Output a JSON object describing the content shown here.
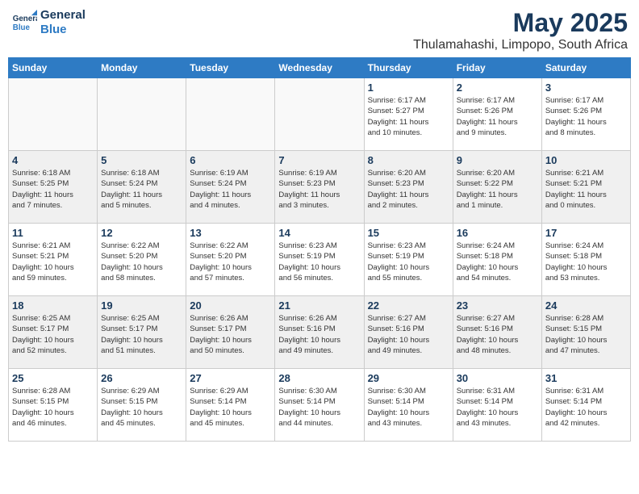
{
  "logo": {
    "line1": "General",
    "line2": "Blue"
  },
  "title": "May 2025",
  "location": "Thulamahashi, Limpopo, South Africa",
  "weekdays": [
    "Sunday",
    "Monday",
    "Tuesday",
    "Wednesday",
    "Thursday",
    "Friday",
    "Saturday"
  ],
  "weeks": [
    [
      {
        "day": "",
        "text": ""
      },
      {
        "day": "",
        "text": ""
      },
      {
        "day": "",
        "text": ""
      },
      {
        "day": "",
        "text": ""
      },
      {
        "day": "1",
        "text": "Sunrise: 6:17 AM\nSunset: 5:27 PM\nDaylight: 11 hours\nand 10 minutes."
      },
      {
        "day": "2",
        "text": "Sunrise: 6:17 AM\nSunset: 5:26 PM\nDaylight: 11 hours\nand 9 minutes."
      },
      {
        "day": "3",
        "text": "Sunrise: 6:17 AM\nSunset: 5:26 PM\nDaylight: 11 hours\nand 8 minutes."
      }
    ],
    [
      {
        "day": "4",
        "text": "Sunrise: 6:18 AM\nSunset: 5:25 PM\nDaylight: 11 hours\nand 7 minutes."
      },
      {
        "day": "5",
        "text": "Sunrise: 6:18 AM\nSunset: 5:24 PM\nDaylight: 11 hours\nand 5 minutes."
      },
      {
        "day": "6",
        "text": "Sunrise: 6:19 AM\nSunset: 5:24 PM\nDaylight: 11 hours\nand 4 minutes."
      },
      {
        "day": "7",
        "text": "Sunrise: 6:19 AM\nSunset: 5:23 PM\nDaylight: 11 hours\nand 3 minutes."
      },
      {
        "day": "8",
        "text": "Sunrise: 6:20 AM\nSunset: 5:23 PM\nDaylight: 11 hours\nand 2 minutes."
      },
      {
        "day": "9",
        "text": "Sunrise: 6:20 AM\nSunset: 5:22 PM\nDaylight: 11 hours\nand 1 minute."
      },
      {
        "day": "10",
        "text": "Sunrise: 6:21 AM\nSunset: 5:21 PM\nDaylight: 11 hours\nand 0 minutes."
      }
    ],
    [
      {
        "day": "11",
        "text": "Sunrise: 6:21 AM\nSunset: 5:21 PM\nDaylight: 10 hours\nand 59 minutes."
      },
      {
        "day": "12",
        "text": "Sunrise: 6:22 AM\nSunset: 5:20 PM\nDaylight: 10 hours\nand 58 minutes."
      },
      {
        "day": "13",
        "text": "Sunrise: 6:22 AM\nSunset: 5:20 PM\nDaylight: 10 hours\nand 57 minutes."
      },
      {
        "day": "14",
        "text": "Sunrise: 6:23 AM\nSunset: 5:19 PM\nDaylight: 10 hours\nand 56 minutes."
      },
      {
        "day": "15",
        "text": "Sunrise: 6:23 AM\nSunset: 5:19 PM\nDaylight: 10 hours\nand 55 minutes."
      },
      {
        "day": "16",
        "text": "Sunrise: 6:24 AM\nSunset: 5:18 PM\nDaylight: 10 hours\nand 54 minutes."
      },
      {
        "day": "17",
        "text": "Sunrise: 6:24 AM\nSunset: 5:18 PM\nDaylight: 10 hours\nand 53 minutes."
      }
    ],
    [
      {
        "day": "18",
        "text": "Sunrise: 6:25 AM\nSunset: 5:17 PM\nDaylight: 10 hours\nand 52 minutes."
      },
      {
        "day": "19",
        "text": "Sunrise: 6:25 AM\nSunset: 5:17 PM\nDaylight: 10 hours\nand 51 minutes."
      },
      {
        "day": "20",
        "text": "Sunrise: 6:26 AM\nSunset: 5:17 PM\nDaylight: 10 hours\nand 50 minutes."
      },
      {
        "day": "21",
        "text": "Sunrise: 6:26 AM\nSunset: 5:16 PM\nDaylight: 10 hours\nand 49 minutes."
      },
      {
        "day": "22",
        "text": "Sunrise: 6:27 AM\nSunset: 5:16 PM\nDaylight: 10 hours\nand 49 minutes."
      },
      {
        "day": "23",
        "text": "Sunrise: 6:27 AM\nSunset: 5:16 PM\nDaylight: 10 hours\nand 48 minutes."
      },
      {
        "day": "24",
        "text": "Sunrise: 6:28 AM\nSunset: 5:15 PM\nDaylight: 10 hours\nand 47 minutes."
      }
    ],
    [
      {
        "day": "25",
        "text": "Sunrise: 6:28 AM\nSunset: 5:15 PM\nDaylight: 10 hours\nand 46 minutes."
      },
      {
        "day": "26",
        "text": "Sunrise: 6:29 AM\nSunset: 5:15 PM\nDaylight: 10 hours\nand 45 minutes."
      },
      {
        "day": "27",
        "text": "Sunrise: 6:29 AM\nSunset: 5:14 PM\nDaylight: 10 hours\nand 45 minutes."
      },
      {
        "day": "28",
        "text": "Sunrise: 6:30 AM\nSunset: 5:14 PM\nDaylight: 10 hours\nand 44 minutes."
      },
      {
        "day": "29",
        "text": "Sunrise: 6:30 AM\nSunset: 5:14 PM\nDaylight: 10 hours\nand 43 minutes."
      },
      {
        "day": "30",
        "text": "Sunrise: 6:31 AM\nSunset: 5:14 PM\nDaylight: 10 hours\nand 43 minutes."
      },
      {
        "day": "31",
        "text": "Sunrise: 6:31 AM\nSunset: 5:14 PM\nDaylight: 10 hours\nand 42 minutes."
      }
    ]
  ]
}
